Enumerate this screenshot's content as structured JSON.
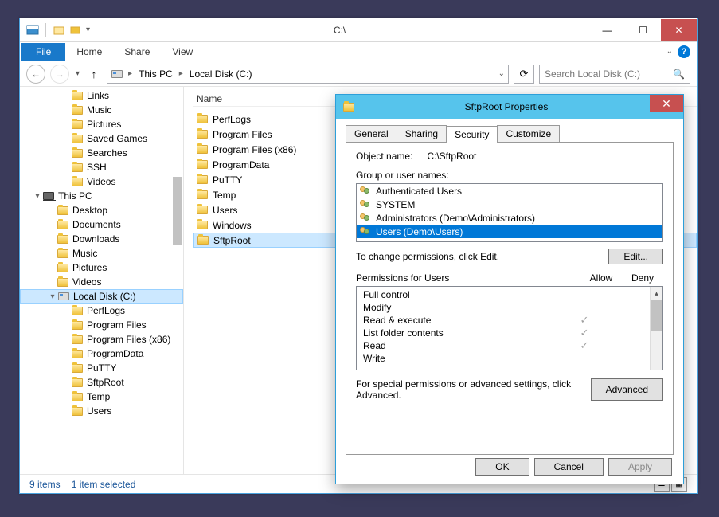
{
  "window": {
    "title": "C:\\",
    "min_tip": "Minimize",
    "max_tip": "Maximize",
    "close_tip": "Close"
  },
  "ribbon": {
    "file": "File",
    "tabs": [
      "Home",
      "Share",
      "View"
    ]
  },
  "nav": {
    "breadcrumb": [
      "This PC",
      "Local Disk (C:)"
    ],
    "search_placeholder": "Search Local Disk (C:)"
  },
  "tree": [
    {
      "label": "Links",
      "depth": 2,
      "icon": "folder"
    },
    {
      "label": "Music",
      "depth": 2,
      "icon": "folder"
    },
    {
      "label": "Pictures",
      "depth": 2,
      "icon": "folder"
    },
    {
      "label": "Saved Games",
      "depth": 2,
      "icon": "folder"
    },
    {
      "label": "Searches",
      "depth": 2,
      "icon": "folder"
    },
    {
      "label": "SSH",
      "depth": 2,
      "icon": "folder"
    },
    {
      "label": "Videos",
      "depth": 2,
      "icon": "folder"
    },
    {
      "label": "This PC",
      "depth": 0,
      "icon": "pc",
      "expanded": true
    },
    {
      "label": "Desktop",
      "depth": 1,
      "icon": "folder"
    },
    {
      "label": "Documents",
      "depth": 1,
      "icon": "folder"
    },
    {
      "label": "Downloads",
      "depth": 1,
      "icon": "folder"
    },
    {
      "label": "Music",
      "depth": 1,
      "icon": "folder"
    },
    {
      "label": "Pictures",
      "depth": 1,
      "icon": "folder"
    },
    {
      "label": "Videos",
      "depth": 1,
      "icon": "folder"
    },
    {
      "label": "Local Disk (C:)",
      "depth": 1,
      "icon": "disk",
      "expanded": true,
      "selected": true
    },
    {
      "label": "PerfLogs",
      "depth": 2,
      "icon": "folder"
    },
    {
      "label": "Program Files",
      "depth": 2,
      "icon": "folder"
    },
    {
      "label": "Program Files (x86)",
      "depth": 2,
      "icon": "folder"
    },
    {
      "label": "ProgramData",
      "depth": 2,
      "icon": "folder"
    },
    {
      "label": "PuTTY",
      "depth": 2,
      "icon": "folder"
    },
    {
      "label": "SftpRoot",
      "depth": 2,
      "icon": "folder"
    },
    {
      "label": "Temp",
      "depth": 2,
      "icon": "folder"
    },
    {
      "label": "Users",
      "depth": 2,
      "icon": "folder"
    }
  ],
  "columns": {
    "name": "Name"
  },
  "files": [
    {
      "name": "PerfLogs"
    },
    {
      "name": "Program Files"
    },
    {
      "name": "Program Files (x86)"
    },
    {
      "name": "ProgramData"
    },
    {
      "name": "PuTTY"
    },
    {
      "name": "Temp"
    },
    {
      "name": "Users"
    },
    {
      "name": "Windows"
    },
    {
      "name": "SftpRoot",
      "selected": true
    }
  ],
  "status": {
    "count": "9 items",
    "selection": "1 item selected"
  },
  "props": {
    "title": "SftpRoot Properties",
    "tabs": [
      "General",
      "Sharing",
      "Security",
      "Customize"
    ],
    "active_tab": 2,
    "object_label": "Object name:",
    "object_value": "C:\\SftpRoot",
    "group_label": "Group or user names:",
    "groups": [
      {
        "name": "Authenticated Users"
      },
      {
        "name": "SYSTEM"
      },
      {
        "name": "Administrators (Demo\\Administrators)"
      },
      {
        "name": "Users (Demo\\Users)",
        "selected": true
      }
    ],
    "edit_hint": "To change permissions, click Edit.",
    "edit_btn": "Edit...",
    "perm_header_prefix": "Permissions for ",
    "perm_header_subject": "Users",
    "allow": "Allow",
    "deny": "Deny",
    "permissions": [
      {
        "name": "Full control",
        "allow": false,
        "deny": false
      },
      {
        "name": "Modify",
        "allow": false,
        "deny": false
      },
      {
        "name": "Read & execute",
        "allow": true,
        "deny": false
      },
      {
        "name": "List folder contents",
        "allow": true,
        "deny": false
      },
      {
        "name": "Read",
        "allow": true,
        "deny": false
      },
      {
        "name": "Write",
        "allow": false,
        "deny": false
      }
    ],
    "advanced_hint": "For special permissions or advanced settings, click Advanced.",
    "advanced_btn": "Advanced",
    "ok": "OK",
    "cancel": "Cancel",
    "apply": "Apply"
  }
}
